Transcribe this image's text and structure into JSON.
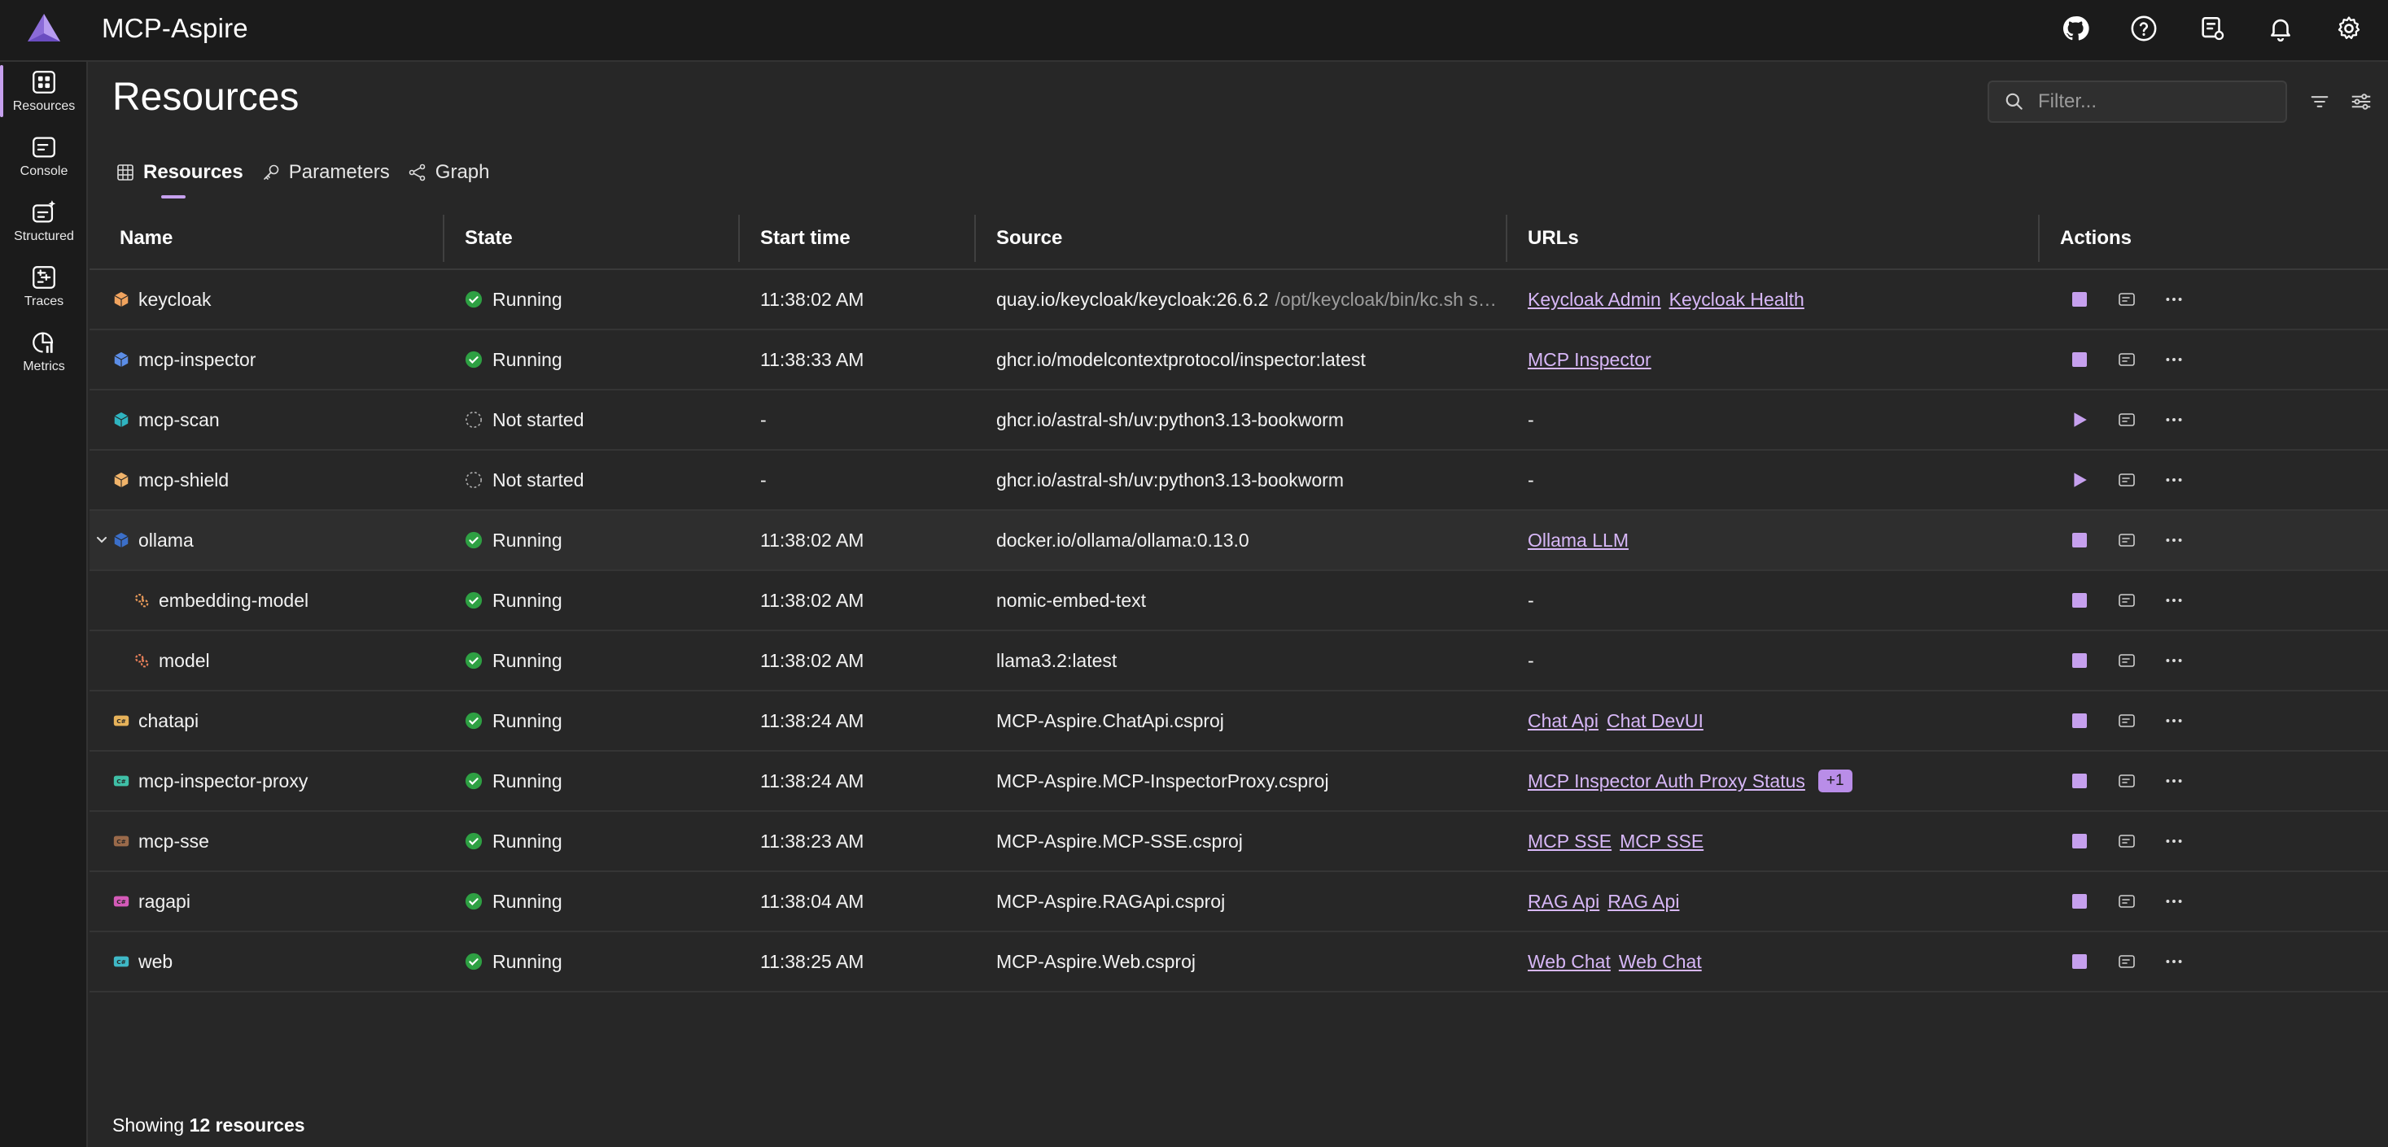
{
  "app": {
    "title": "MCP-Aspire"
  },
  "topbar": {
    "icons": [
      "github-icon",
      "help-icon",
      "developer-tools-icon",
      "notifications-icon",
      "settings-icon"
    ]
  },
  "nav": {
    "items": [
      {
        "label": "Resources",
        "icon": "resources-icon",
        "active": true
      },
      {
        "label": "Console",
        "icon": "console-icon"
      },
      {
        "label": "Structured",
        "icon": "structured-logs-icon"
      },
      {
        "label": "Traces",
        "icon": "traces-icon"
      },
      {
        "label": "Metrics",
        "icon": "metrics-icon"
      }
    ]
  },
  "page": {
    "title": "Resources"
  },
  "filter": {
    "placeholder": "Filter..."
  },
  "tabs": [
    {
      "label": "Resources",
      "icon": "grid-icon",
      "active": true
    },
    {
      "label": "Parameters",
      "icon": "key-icon"
    },
    {
      "label": "Graph",
      "icon": "graph-icon"
    }
  ],
  "table": {
    "headers": {
      "name": "Name",
      "state": "State",
      "start": "Start time",
      "source": "Source",
      "urls": "URLs",
      "actions": "Actions"
    },
    "rows": [
      {
        "name": "keycloak",
        "type": "container",
        "iconColor": "#f0a35e",
        "state": "Running",
        "start": "11:38:02 AM",
        "source": "quay.io/keycloak/keycloak:26.6.2",
        "sourceExtra": "/opt/keycloak/bin/kc.sh s…",
        "urls": [
          "Keycloak Admin",
          "Keycloak Health"
        ],
        "badge": "",
        "running": true
      },
      {
        "name": "mcp-inspector",
        "type": "container",
        "iconColor": "#5b8de6",
        "state": "Running",
        "start": "11:38:33 AM",
        "source": "ghcr.io/modelcontextprotocol/inspector:latest",
        "sourceExtra": "",
        "urls": [
          "MCP Inspector"
        ],
        "badge": "",
        "running": true
      },
      {
        "name": "mcp-scan",
        "type": "container",
        "iconColor": "#2fb4c0",
        "state": "Not started",
        "start": "-",
        "source": "ghcr.io/astral-sh/uv:python3.13-bookworm",
        "sourceExtra": "",
        "urls": [],
        "noUrl": "-",
        "badge": "",
        "running": false
      },
      {
        "name": "mcp-shield",
        "type": "container",
        "iconColor": "#f0b36a",
        "state": "Not started",
        "start": "-",
        "source": "ghcr.io/astral-sh/uv:python3.13-bookworm",
        "sourceExtra": "",
        "urls": [],
        "noUrl": "-",
        "badge": "",
        "running": false
      },
      {
        "name": "ollama",
        "type": "container",
        "iconColor": "#3b6fc9",
        "state": "Running",
        "start": "11:38:02 AM",
        "source": "docker.io/ollama/ollama:0.13.0",
        "sourceExtra": "",
        "urls": [
          "Ollama LLM"
        ],
        "badge": "",
        "running": true,
        "expandable": true
      },
      {
        "name": "embedding-model",
        "type": "model",
        "iconColor": "#e89a5a",
        "state": "Running",
        "start": "11:38:02 AM",
        "source": "nomic-embed-text",
        "sourceExtra": "",
        "urls": [],
        "noUrl": "-",
        "badge": "",
        "running": true,
        "child": true
      },
      {
        "name": "model",
        "type": "model",
        "iconColor": "#e8805a",
        "state": "Running",
        "start": "11:38:02 AM",
        "source": "llama3.2:latest",
        "sourceExtra": "",
        "urls": [],
        "noUrl": "-",
        "badge": "",
        "running": true,
        "child": true
      },
      {
        "name": "chatapi",
        "type": "project",
        "iconColor": "#e6b25a",
        "state": "Running",
        "start": "11:38:24 AM",
        "source": "MCP-Aspire.ChatApi.csproj",
        "sourceExtra": "",
        "urls": [
          "Chat Api",
          "Chat DevUI"
        ],
        "badge": "",
        "running": true
      },
      {
        "name": "mcp-inspector-proxy",
        "type": "project",
        "iconColor": "#3fbfa6",
        "state": "Running",
        "start": "11:38:24 AM",
        "source": "MCP-Aspire.MCP-InspectorProxy.csproj",
        "sourceExtra": "",
        "urls": [
          "MCP Inspector Auth Proxy Status"
        ],
        "badge": "+1",
        "running": true
      },
      {
        "name": "mcp-sse",
        "type": "project",
        "iconColor": "#9a6a4a",
        "state": "Running",
        "start": "11:38:23 AM",
        "source": "MCP-Aspire.MCP-SSE.csproj",
        "sourceExtra": "",
        "urls": [
          "MCP SSE",
          "MCP SSE"
        ],
        "badge": "",
        "running": true
      },
      {
        "name": "ragapi",
        "type": "project",
        "iconColor": "#d45ab8",
        "state": "Running",
        "start": "11:38:04 AM",
        "source": "MCP-Aspire.RAGApi.csproj",
        "sourceExtra": "",
        "urls": [
          "RAG Api",
          "RAG Api"
        ],
        "badge": "",
        "running": true
      },
      {
        "name": "web",
        "type": "project",
        "iconColor": "#3fb8c6",
        "state": "Running",
        "start": "11:38:25 AM",
        "source": "MCP-Aspire.Web.csproj",
        "sourceExtra": "",
        "urls": [
          "Web Chat",
          "Web Chat"
        ],
        "badge": "",
        "running": true
      }
    ]
  },
  "footer": {
    "prefix": "Showing",
    "count": "12 resources"
  },
  "colors": {
    "accent": "#c6a0ee",
    "running": "#2ea043",
    "link": "#d7b7f7"
  }
}
